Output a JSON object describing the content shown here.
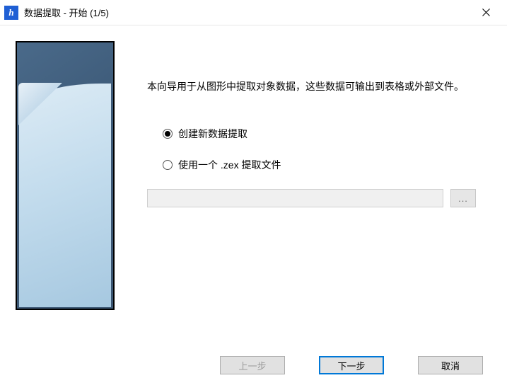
{
  "window": {
    "title": "数据提取 - 开始 (1/5)"
  },
  "intro": "本向导用于从图形中提取对象数据，这些数据可输出到表格或外部文件。",
  "options": {
    "create_new": "创建新数据提取",
    "use_file": "使用一个 .zex 提取文件"
  },
  "file_path": "",
  "browse_label": "...",
  "buttons": {
    "back": "上一步",
    "next": "下一步",
    "cancel": "取消"
  },
  "state": {
    "selected_option": "create_new",
    "back_enabled": false,
    "browse_enabled": false,
    "file_input_enabled": false
  }
}
